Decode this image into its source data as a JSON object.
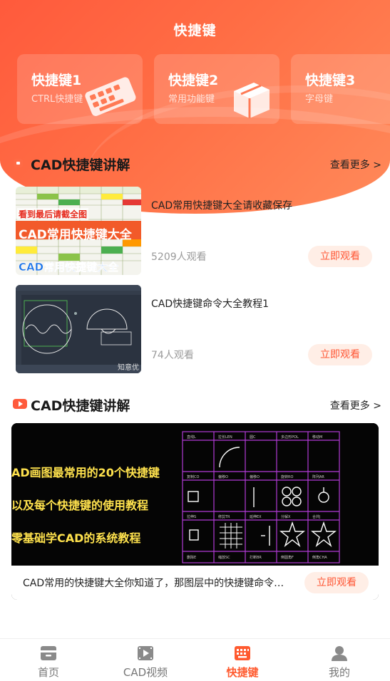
{
  "header": {
    "title": "快捷键"
  },
  "cards": [
    {
      "title": "快捷键1",
      "subtitle": "CTRL快捷键"
    },
    {
      "title": "快捷键2",
      "subtitle": "常用功能键"
    },
    {
      "title": "快捷键3",
      "subtitle": "字母键"
    }
  ],
  "section1": {
    "title": "CAD快捷键讲解",
    "more": "查看更多 >",
    "videos": [
      {
        "title": "CAD常用快捷键大全请收藏保存",
        "views": "5209人观看",
        "button": "立即观看",
        "thumb_top": "看到最后请截全图",
        "thumb_mid": "CAD常用快捷键大全",
        "thumb_bottom": "CAD常用快捷键大全"
      },
      {
        "title": "CAD快捷键命令大全教程1",
        "views": "74人观看",
        "button": "立即观看",
        "thumb_watermark": "知意优"
      }
    ]
  },
  "section2": {
    "title": "CAD快捷键讲解",
    "more": "查看更多 >",
    "feature": {
      "line1": "AD画图最常用的20个快捷键",
      "line2": "以及每个快捷键的使用教程",
      "line3": "零基础学CAD的系统教程",
      "caption": "CAD常用的快捷键大全你知道了，那图层中的快捷键命令…",
      "button": "立即观看"
    }
  },
  "tabbar": {
    "items": [
      {
        "label": "首页",
        "icon": "home-icon"
      },
      {
        "label": "CAD视频",
        "icon": "video-icon"
      },
      {
        "label": "快捷键",
        "icon": "keyboard-icon"
      },
      {
        "label": "我的",
        "icon": "user-icon"
      }
    ],
    "active_index": 2
  },
  "colors": {
    "accent": "#ff5a2f",
    "header": "#ff6644",
    "button_bg": "#ffeee6"
  }
}
